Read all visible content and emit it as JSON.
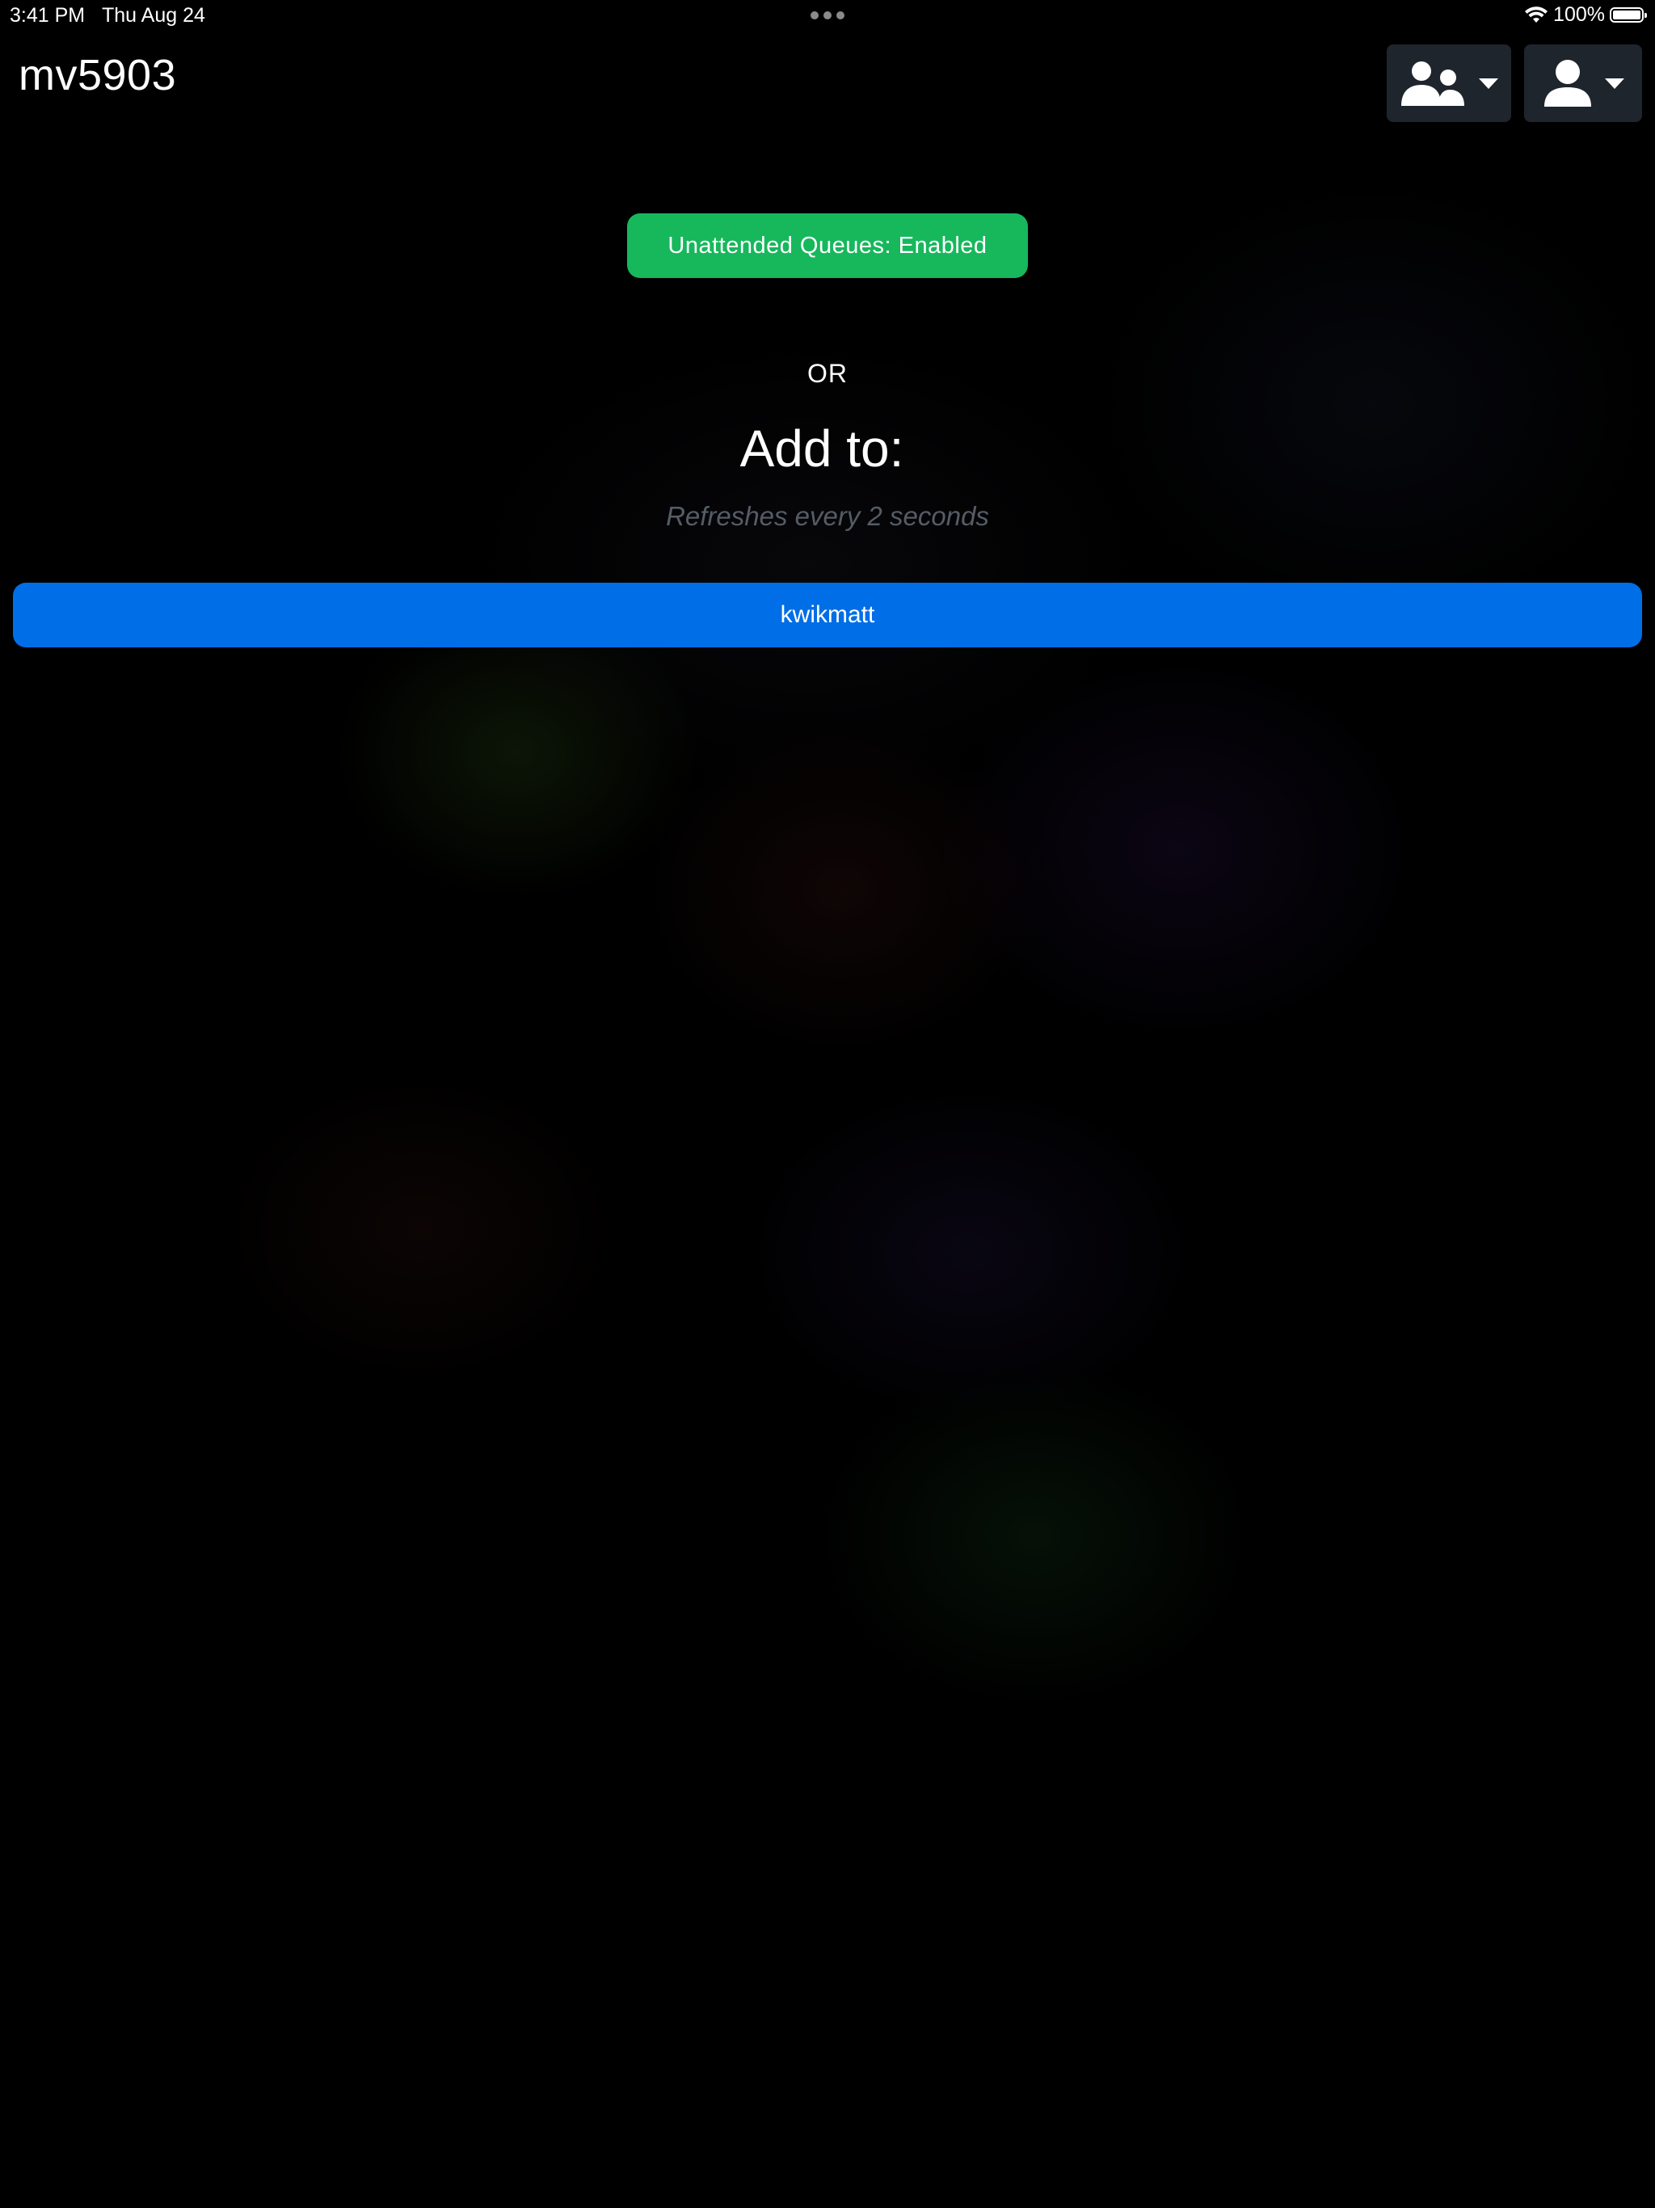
{
  "status_bar": {
    "time": "3:41 PM",
    "date": "Thu Aug 24",
    "battery": "100%"
  },
  "header": {
    "title": "mv5903",
    "groups_icon": "users-icon",
    "user_icon": "user-icon"
  },
  "main": {
    "unattended_button": "Unattended Queues: Enabled",
    "or_text": "OR",
    "add_heading": "Add to:",
    "refresh_note": "Refreshes every 2 seconds",
    "queues": [
      {
        "label": "kwikmatt"
      }
    ]
  },
  "colors": {
    "background": "#000000",
    "enabled_green": "#16b85b",
    "queue_blue": "#006ee6",
    "header_button": "#1f252c",
    "muted_text": "#555c66"
  }
}
